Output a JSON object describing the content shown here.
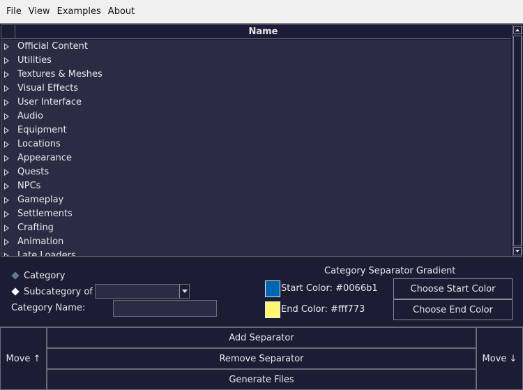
{
  "menu": {
    "items": [
      {
        "label": "File"
      },
      {
        "label": "View"
      },
      {
        "label": "Examples"
      },
      {
        "label": "About"
      }
    ]
  },
  "tree": {
    "column_header": "Name",
    "items": [
      {
        "label": "Official Content"
      },
      {
        "label": "Utilities"
      },
      {
        "label": "Textures & Meshes"
      },
      {
        "label": "Visual Effects"
      },
      {
        "label": "User Interface"
      },
      {
        "label": "Audio"
      },
      {
        "label": "Equipment"
      },
      {
        "label": "Locations"
      },
      {
        "label": "Appearance"
      },
      {
        "label": "Quests"
      },
      {
        "label": "NPCs"
      },
      {
        "label": "Gameplay"
      },
      {
        "label": "Settlements"
      },
      {
        "label": "Crafting"
      },
      {
        "label": "Animation"
      },
      {
        "label": "Late Loaders"
      }
    ]
  },
  "options": {
    "category_label": "Category",
    "subcategory_label": "Subcategory of",
    "subcategory_value": "",
    "category_name_label": "Category Name:",
    "category_name_value": ""
  },
  "gradient": {
    "title": "Category Separator Gradient",
    "start_label": "Start Color: #0066b1",
    "start_color": "#0066b1",
    "end_label": "End Color: #fff773",
    "end_color": "#fff773",
    "choose_start_label": "Choose Start Color",
    "choose_end_label": "Choose End Color"
  },
  "actions": {
    "move_up_label": "Move ↑",
    "move_down_label": "Move ↓",
    "add_label": "Add Separator",
    "remove_label": "Remove Separator",
    "generate_label": "Generate Files"
  }
}
